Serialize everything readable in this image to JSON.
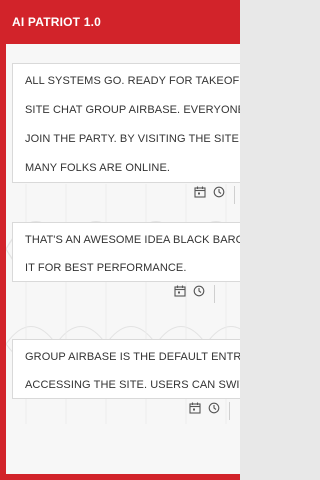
{
  "app": {
    "title": "AI PATRIOT 1.0"
  },
  "messages": [
    {
      "lines": [
        "ALL SYSTEMS GO. READY FOR TAKEOFF.",
        "SITE CHAT GROUP AIRBASE. EVERYONE I",
        "JOIN THE PARTY. BY VISITING THE SITE Y",
        "MANY FOLKS ARE ONLINE."
      ]
    },
    {
      "lines": [
        "THAT'S AN AWESOME IDEA BLACK BARC",
        "IT FOR BEST PERFORMANCE."
      ]
    },
    {
      "lines": [
        "GROUP AIRBASE IS THE DEFAULT ENTRY",
        "ACCESSING THE SITE. USERS CAN SWITC"
      ]
    }
  ],
  "colors": {
    "accent": "#d2232a",
    "card_bg": "#ffffff",
    "text": "#333333"
  },
  "icons": [
    "calendar-icon",
    "clock-icon"
  ]
}
